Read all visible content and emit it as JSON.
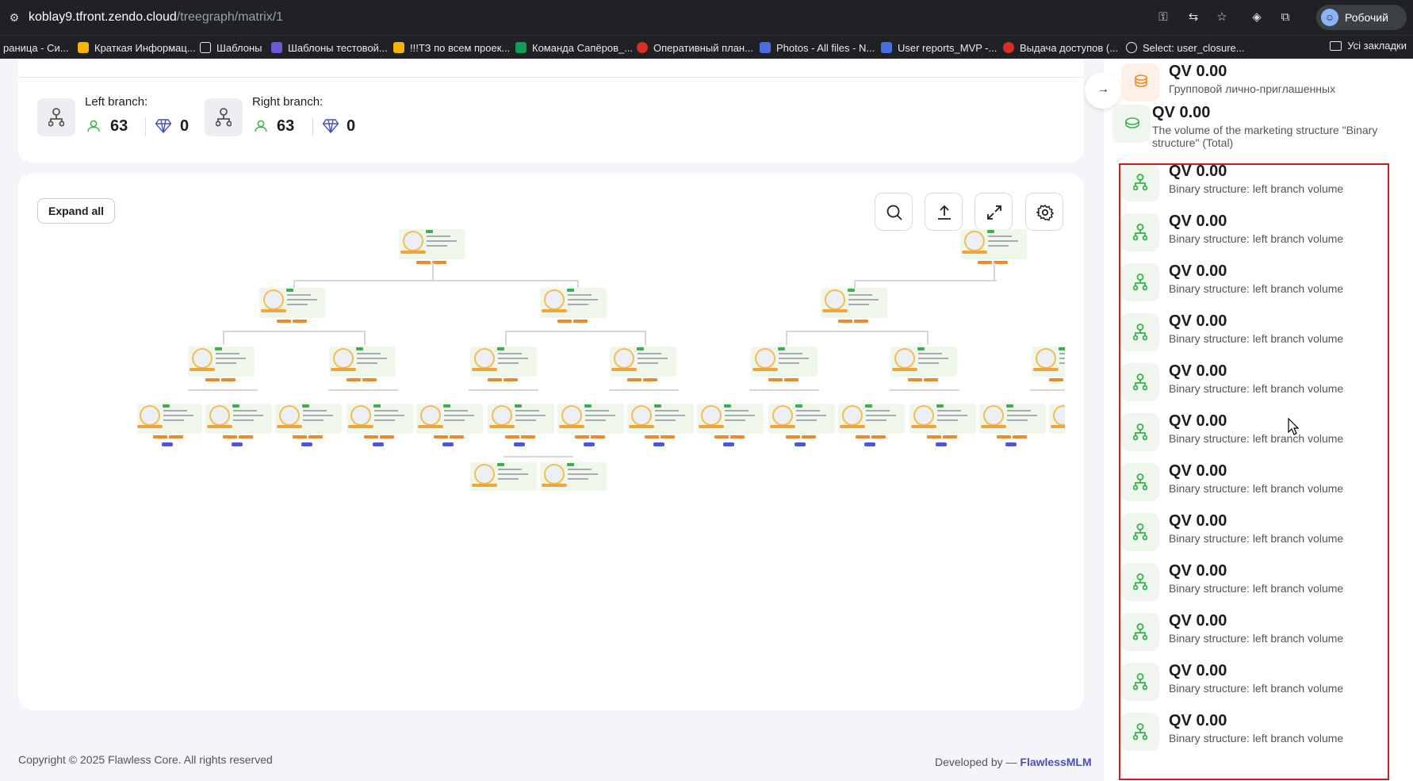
{
  "browser": {
    "url_host": "koblay9.tfront.zendo.cloud",
    "url_path": "/treegraph/matrix/1",
    "profile_label": "Робочий",
    "bookmarks": [
      {
        "label": "раница - Си...",
        "color": "#8ab4f8"
      },
      {
        "label": "Краткая Информац...",
        "color": "#f4b400"
      },
      {
        "label": "Шаблоны",
        "color": "#e8eaed"
      },
      {
        "label": "Шаблоны тестовой...",
        "color": "#6b5bd6"
      },
      {
        "label": "!!!ТЗ по всем проек...",
        "color": "#f4b400"
      },
      {
        "label": "Команда Сапёров_...",
        "color": "#0f9d58"
      },
      {
        "label": "Оперативный план...",
        "color": "#d93025"
      },
      {
        "label": "Photos - All files - N...",
        "color": "#4a6ee0"
      },
      {
        "label": "User reports_MVP -...",
        "color": "#4a6ee0"
      },
      {
        "label": "Выдача доступов (...",
        "color": "#d93025"
      },
      {
        "label": "Select: user_closure...",
        "color": "#e8eaed"
      }
    ],
    "all_bookmarks_label": "Усі закладки"
  },
  "branches": {
    "left": {
      "title": "Left branch:",
      "users": "63",
      "gems": "0"
    },
    "right": {
      "title": "Right branch:",
      "users": "63",
      "gems": "0"
    }
  },
  "tree": {
    "expand_all_label": "Expand all",
    "tools": [
      "search-icon",
      "upload-icon",
      "expand-icon",
      "settings-icon"
    ]
  },
  "footer": {
    "copyright": "Copyright © 2025 Flawless Core. All rights reserved",
    "developed_by": "Developed by —",
    "developer": "FlawlessMLM"
  },
  "panel": {
    "items": [
      {
        "value": "QV 0.00",
        "label": "Групповой лично-приглашенных",
        "icon": "coins-icon"
      },
      {
        "value": "QV 0.00",
        "label": "The volume of the marketing structure \"Binary structure\" (Total)",
        "icon": "coin-icon"
      },
      {
        "value": "QV 0.00",
        "label": "Binary structure: left branch volume",
        "icon": "binary-tree-icon"
      },
      {
        "value": "QV 0.00",
        "label": "Binary structure: left branch volume",
        "icon": "binary-tree-icon"
      },
      {
        "value": "QV 0.00",
        "label": "Binary structure: left branch volume",
        "icon": "binary-tree-icon"
      },
      {
        "value": "QV 0.00",
        "label": "Binary structure: left branch volume",
        "icon": "binary-tree-icon"
      },
      {
        "value": "QV 0.00",
        "label": "Binary structure: left branch volume",
        "icon": "binary-tree-icon"
      },
      {
        "value": "QV 0.00",
        "label": "Binary structure: left branch volume",
        "icon": "binary-tree-icon"
      },
      {
        "value": "QV 0.00",
        "label": "Binary structure: left branch volume",
        "icon": "binary-tree-icon"
      },
      {
        "value": "QV 0.00",
        "label": "Binary structure: left branch volume",
        "icon": "binary-tree-icon"
      },
      {
        "value": "QV 0.00",
        "label": "Binary structure: left branch volume",
        "icon": "binary-tree-icon"
      },
      {
        "value": "QV 0.00",
        "label": "Binary structure: left branch volume",
        "icon": "binary-tree-icon"
      },
      {
        "value": "QV 0.00",
        "label": "Binary structure: left branch volume",
        "icon": "binary-tree-icon"
      },
      {
        "value": "QV 0.00",
        "label": "Binary structure: left branch volume",
        "icon": "binary-tree-icon"
      }
    ]
  },
  "colors": {
    "accent": "#4a4fbf",
    "highlight": "#d31d1d",
    "success": "#37b24d"
  }
}
